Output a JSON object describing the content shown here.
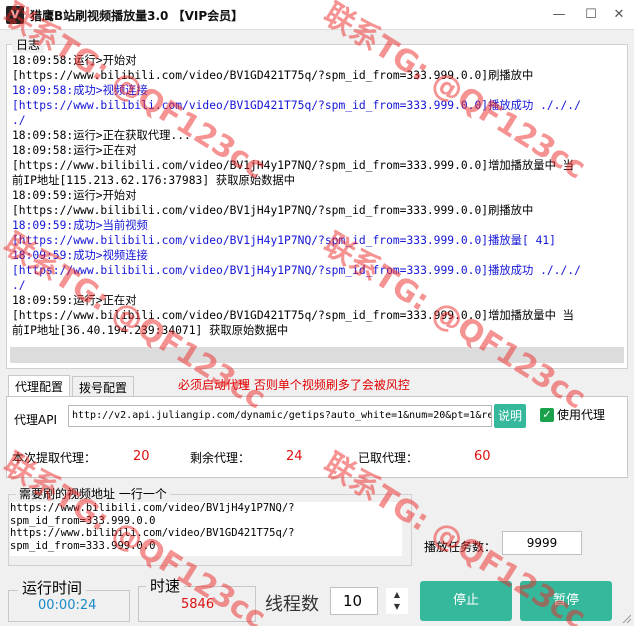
{
  "window": {
    "icon_glyph": "V",
    "title": "猎鹰B站刷视频播放量3.0 【VIP会员】",
    "minimize_glyph": "—",
    "maximize_glyph": "☐",
    "close_glyph": "✕"
  },
  "log": {
    "legend": "日志",
    "lines": [
      {
        "text": "18:09:58:运行>开始对",
        "kind": "info"
      },
      {
        "text": "[https://www.bilibili.com/video/BV1GD421T75q/?spm_id_from=333.999.0.0]刷播放中",
        "kind": "info"
      },
      {
        "text": "18:09:58:成功>视频连接",
        "kind": "success"
      },
      {
        "text": "[https://www.bilibili.com/video/BV1GD421T75q/?spm_id_from=333.999.0.0]播放成功 ./././",
        "kind": "success"
      },
      {
        "text": "./",
        "kind": "success"
      },
      {
        "text": "18:09:58:运行>正在获取代理...",
        "kind": "info"
      },
      {
        "text": "18:09:58:运行>正在对",
        "kind": "info"
      },
      {
        "text": "[https://www.bilibili.com/video/BV1jH4y1P7NQ/?spm_id_from=333.999.0.0]增加播放量中 当",
        "kind": "info"
      },
      {
        "text": "前IP地址[115.213.62.176:37983] 获取原始数据中",
        "kind": "info"
      },
      {
        "text": "18:09:59:运行>开始对",
        "kind": "info"
      },
      {
        "text": "[https://www.bilibili.com/video/BV1jH4y1P7NQ/?spm_id_from=333.999.0.0]刷播放中",
        "kind": "info"
      },
      {
        "text": "18:09:59:成功>当前视频",
        "kind": "success"
      },
      {
        "text": "[https://www.bilibili.com/video/BV1jH4y1P7NQ/?spm_id_from=333.999.0.0]播放量[ 41]",
        "kind": "success"
      },
      {
        "text": "18:09:59:成功>视频连接",
        "kind": "success"
      },
      {
        "text": "[https://www.bilibili.com/video/BV1jH4y1P7NQ/?spm_id_from=333.999.0.0]播放成功 ./././",
        "kind": "success"
      },
      {
        "text": "./",
        "kind": "success"
      },
      {
        "text": "18:09:59:运行>正在对",
        "kind": "info"
      },
      {
        "text": "[https://www.bilibili.com/video/BV1GD421T75q/?spm_id_from=333.999.0.0]增加播放量中 当",
        "kind": "info"
      },
      {
        "text": "前IP地址[36.40.194.239:34071] 获取原始数据中",
        "kind": "info"
      }
    ]
  },
  "tabs": [
    {
      "label": "代理配置",
      "active": true
    },
    {
      "label": "拨号配置",
      "active": false
    }
  ],
  "warning": "必须启动代理 否则单个视频刷多了会被风控",
  "proxy": {
    "api_label": "代理API",
    "api_value": "http://v2.api.juliangip.com/dynamic/getips?auto_white=1&num=20&pt=1&re",
    "explain_button": "说明",
    "use_proxy_label": "使用代理",
    "use_proxy_checked": true,
    "checkmark": "✓"
  },
  "stats": [
    {
      "label": "本次提取代理：",
      "value": "20"
    },
    {
      "label": "剩余代理：",
      "value": "24"
    },
    {
      "label": "已取代理：",
      "value": "60"
    }
  ],
  "urls": {
    "legend": "需要刷的视频地址  一行一个",
    "lines": [
      "https://www.bilibili.com/video/BV1jH4y1P7NQ/?",
      "spm_id_from=333.999.0.0",
      "https://www.bilibili.com/video/BV1GD421T75q/?",
      "spm_id_from=333.999.0.0"
    ]
  },
  "tasks": {
    "label": "播放任务数：",
    "value": "9999"
  },
  "runtime": {
    "label": "运行时间",
    "value": "00:00:24"
  },
  "speed": {
    "label": "时速",
    "value": "5846"
  },
  "threads": {
    "label": "线程数",
    "value": "10",
    "up_glyph": "▲",
    "down_glyph": "▼"
  },
  "buttons": {
    "stop": "停止",
    "pause": "暂停"
  },
  "watermark": "联系TG: @QF123cc",
  "colors": {
    "accent": "#36b89d",
    "log_success": "#1515d6",
    "value_red": "#e01010",
    "runtime_blue": "#1a8ac8",
    "checkbox_green": "#1aa14c",
    "watermark_red": "#eb2828"
  }
}
